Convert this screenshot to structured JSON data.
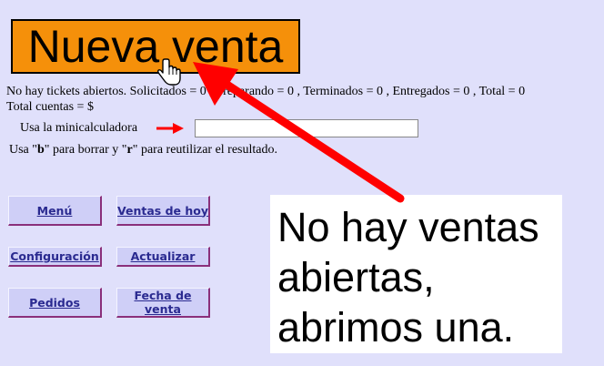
{
  "new_sale_button": {
    "label": "Nueva venta",
    "color": "#f5900a"
  },
  "status": {
    "line": "No hay tickets abiertos. Solicitados = 0 , Preparando = 0 , Terminados = 0 , Entregados = 0 , Total = 0",
    "total_accounts": "Total cuentas = $"
  },
  "calculator": {
    "label": "Usa la minicalculadora",
    "arrow_icon": "right-arrow-icon",
    "input_value": "",
    "hint_prefix": "Usa \"",
    "hint_key_b": "b",
    "hint_middle": "\" para borrar y \"",
    "hint_key_r": "r",
    "hint_suffix": "\" para reutilizar el resultado."
  },
  "nav": {
    "menu": "Menú",
    "ventas_hoy": "Ventas de hoy",
    "configuracion": "Configuración",
    "actualizar": "Actualizar",
    "pedidos": "Pedidos",
    "fecha_venta": "Fecha de venta"
  },
  "annotation": {
    "line1": "No hay ventas",
    "line2": "abiertas,",
    "line3": "abrimos una.",
    "arrow_color": "#ff0000"
  },
  "colors": {
    "background": "#e0e0fb",
    "button_bg": "#cfcff7",
    "button_text": "#2a2a90",
    "button_border": "#8a2f7a"
  }
}
